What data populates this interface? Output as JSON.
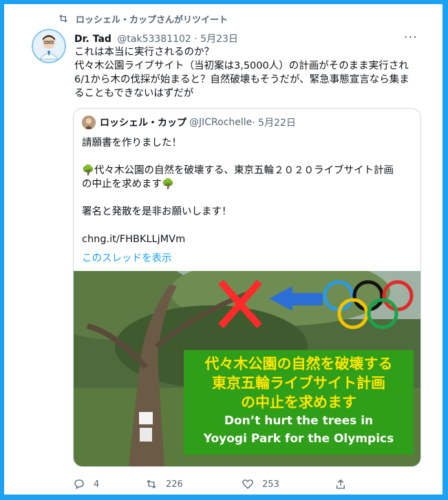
{
  "retweet_banner": {
    "text": "ロッシェル・カップさんがリツイート"
  },
  "tweet": {
    "author_name": "Dr. Tad",
    "author_handle": "@tak53381102",
    "date": "· 5月23日",
    "more": "···",
    "text": "これは本当に実行されるのか？\n代々木公園ライブサイト（当初案は3,5000人）の計画がそのまま実行され\n6/1から木の伐採が始まると？自然破壊もそうだが、緊急事態宣言なら集ま\nることもできないはずだが"
  },
  "quote": {
    "author_name": "ロッシェル・カップ",
    "author_handle": "@JICRochelle",
    "date": "· 5月22日",
    "text": "請願書を作りました！\n\n🌳代々木公園の自然を破壊する、東京五輪２０２０ライブサイト計画\nの中止を求めます🌳\n\n署名と発散を是非お願いします！",
    "link": "chng.it/FHBKLLjMVm",
    "show_thread": "このスレッドを表示",
    "image": {
      "jp_line1": "代々木公園の自然を破壊する",
      "jp_line2": "東京五輪ライブサイト計画",
      "jp_line3": "の中止を求めます",
      "en_line1": "Don’t hurt the trees in",
      "en_line2": "Yoyogi Park for the Olympics"
    }
  },
  "actions": {
    "reply_count": "4",
    "retweet_count": "226",
    "like_count": "253"
  },
  "colors": {
    "accent": "#1DA1F2",
    "banner_green": "#2f9e18",
    "banner_yellow": "#ffe600"
  }
}
